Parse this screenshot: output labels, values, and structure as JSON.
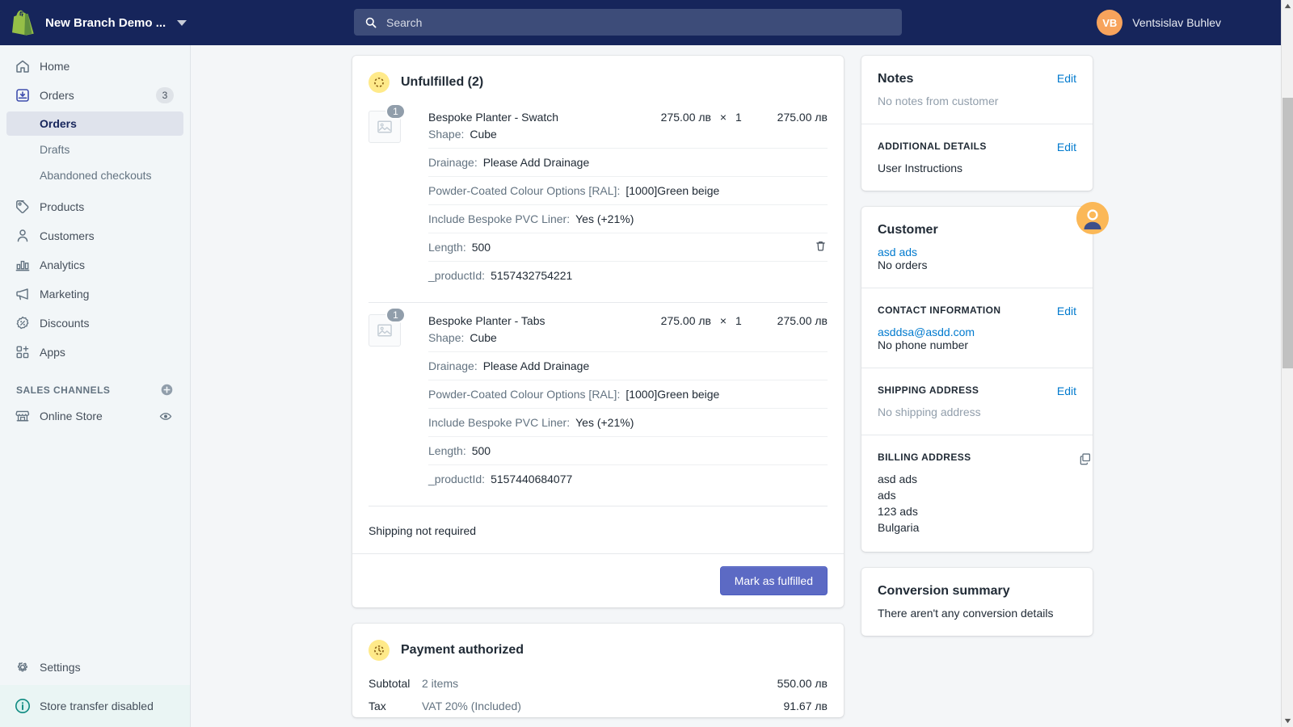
{
  "topbar": {
    "store_name": "New Branch Demo ...",
    "store_menu_icon": "chevron-down-icon",
    "search_placeholder": "Search",
    "search_value": "",
    "search_icon": "search-icon",
    "user_initials": "VB",
    "user_name": "Ventsislav Buhlev",
    "bg_color": "#16255b",
    "accent_color": "#f7a35c"
  },
  "sidebar": {
    "items": [
      {
        "label": "Home",
        "icon": "home-icon",
        "badge": ""
      },
      {
        "label": "Orders",
        "icon": "orders-icon",
        "badge": "3"
      },
      {
        "label": "Products",
        "icon": "products-tag-icon",
        "badge": ""
      },
      {
        "label": "Customers",
        "icon": "customers-person-icon",
        "badge": ""
      },
      {
        "label": "Analytics",
        "icon": "analytics-bars-icon",
        "badge": ""
      },
      {
        "label": "Marketing",
        "icon": "marketing-megaphone-icon",
        "badge": ""
      },
      {
        "label": "Discounts",
        "icon": "discounts-percent-icon",
        "badge": ""
      },
      {
        "label": "Apps",
        "icon": "apps-grid-plus-icon",
        "badge": ""
      }
    ],
    "orders_subitems": [
      {
        "label": "Orders",
        "active": true
      },
      {
        "label": "Drafts",
        "active": false
      },
      {
        "label": "Abandoned checkouts",
        "active": false
      }
    ],
    "sales_channels": {
      "title": "SALES CHANNELS",
      "add_icon": "plus-circle-icon",
      "items": [
        {
          "label": "Online Store",
          "icon": "online-store-icon",
          "trailing_icon": "eye-icon"
        }
      ]
    },
    "settings": {
      "label": "Settings",
      "icon": "gear-icon"
    },
    "store_transfer": {
      "label": "Store transfer disabled",
      "icon": "info-circle-icon"
    }
  },
  "order": {
    "fulfillment": {
      "status_icon": "unfulfilled-dashed-circle-icon",
      "title": "Unfulfilled (2)",
      "line_items": [
        {
          "quantity_badge": "1",
          "thumb_icon": "image-placeholder-icon",
          "title": "Bespoke Planter - Swatch",
          "unit_price": "275.00 лв",
          "times": "×",
          "quantity": "1",
          "line_total": "275.00 лв",
          "properties": [
            {
              "key": "Shape:",
              "value": "Cube",
              "has_delete": false
            },
            {
              "key": "Drainage:",
              "value": "Please Add Drainage",
              "has_delete": false
            },
            {
              "key": "Powder-Coated Colour Options [RAL]:",
              "value": "[1000]Green beige",
              "has_delete": false
            },
            {
              "key": "Include Bespoke PVC Liner:",
              "value": "Yes (+21%)",
              "has_delete": false
            },
            {
              "key": "Length:",
              "value": "500",
              "has_delete": true
            },
            {
              "key": "_productId:",
              "value": "5157432754221",
              "has_delete": false
            }
          ]
        },
        {
          "quantity_badge": "1",
          "thumb_icon": "image-placeholder-icon",
          "title": "Bespoke Planter - Tabs",
          "unit_price": "275.00 лв",
          "times": "×",
          "quantity": "1",
          "line_total": "275.00 лв",
          "properties": [
            {
              "key": "Shape:",
              "value": "Cube",
              "has_delete": false
            },
            {
              "key": "Drainage:",
              "value": "Please Add Drainage",
              "has_delete": false
            },
            {
              "key": "Powder-Coated Colour Options [RAL]:",
              "value": "[1000]Green beige",
              "has_delete": false
            },
            {
              "key": "Include Bespoke PVC Liner:",
              "value": "Yes (+21%)",
              "has_delete": false
            },
            {
              "key": "Length:",
              "value": "500",
              "has_delete": false
            },
            {
              "key": "_productId:",
              "value": "5157440684077",
              "has_delete": false
            }
          ]
        }
      ],
      "shipping_note": "Shipping not required",
      "fulfill_button": "Mark as fulfilled"
    },
    "payment": {
      "status_icon": "payment-clock-icon",
      "title": "Payment authorized",
      "rows": [
        {
          "label": "Subtotal",
          "sub": "2 items",
          "amount": "550.00 лв"
        },
        {
          "label": "Tax",
          "sub": "VAT 20% (Included)",
          "amount": "91.67 лв"
        }
      ]
    }
  },
  "side": {
    "notes": {
      "title": "Notes",
      "edit_label": "Edit",
      "empty_text": "No notes from customer"
    },
    "additional_details": {
      "title": "ADDITIONAL DETAILS",
      "edit_label": "Edit",
      "text": "User Instructions"
    },
    "customer": {
      "title": "Customer",
      "avatar_icon": "customer-avatar-icon",
      "name": "asd ads",
      "orders_text": "No orders"
    },
    "contact": {
      "title": "CONTACT INFORMATION",
      "edit_label": "Edit",
      "email": "asddsa@asdd.com",
      "phone": "No phone number"
    },
    "shipping_address": {
      "title": "SHIPPING ADDRESS",
      "edit_label": "Edit",
      "empty_text": "No shipping address"
    },
    "billing_address": {
      "title": "BILLING ADDRESS",
      "copy_icon": "copy-icon",
      "lines": [
        "asd ads",
        "ads",
        "123 ads",
        "Bulgaria"
      ]
    },
    "conversion": {
      "title": "Conversion summary",
      "empty_text": "There aren't any conversion details"
    }
  },
  "scrollbar": {
    "up_icon": "scroll-up-arrow-icon",
    "down_icon": "scroll-down-arrow-icon"
  }
}
